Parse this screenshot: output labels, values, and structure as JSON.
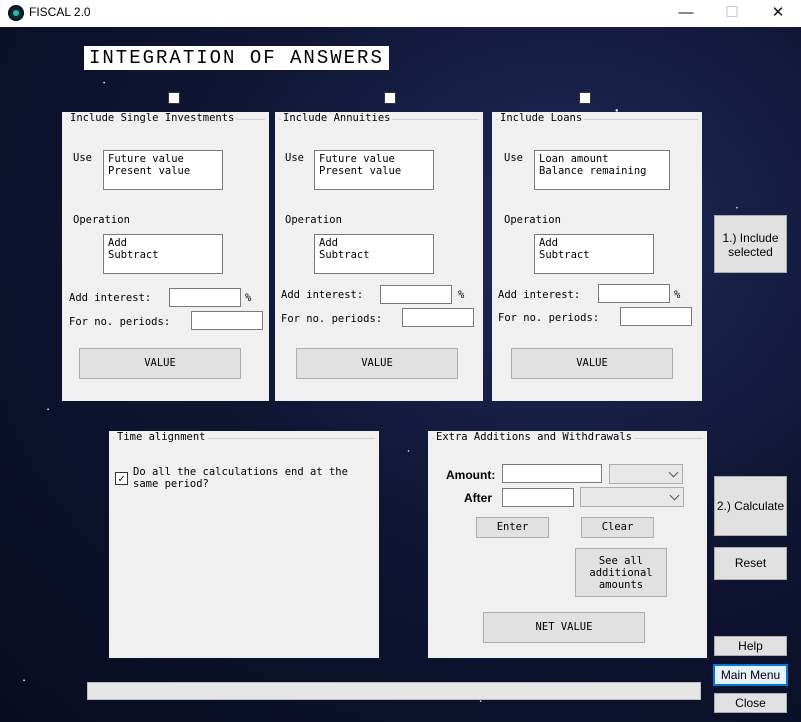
{
  "window": {
    "title": "FISCAL 2.0",
    "minimize": "—",
    "maximize": "☐",
    "close": "✕"
  },
  "heading": "INTEGRATION OF ANSWERS",
  "panels": [
    {
      "title": "Include Single Investments",
      "use_label": "Use",
      "use_items": [
        "Future value",
        "Present value"
      ],
      "operation_label": "Operation",
      "operation_items": [
        "Add",
        "Subtract"
      ],
      "interest_label": "Add interest:",
      "percent": "%",
      "periods_label": "For no. periods:",
      "value_button": "VALUE"
    },
    {
      "title": "Include Annuities",
      "use_label": "Use",
      "use_items": [
        "Future value",
        "Present value"
      ],
      "operation_label": "Operation",
      "operation_items": [
        "Add",
        "Subtract"
      ],
      "interest_label": "Add interest:",
      "percent": "%",
      "periods_label": "For no. periods:",
      "value_button": "VALUE"
    },
    {
      "title": "Include Loans",
      "use_label": "Use",
      "use_items": [
        "Loan amount",
        "Balance remaining"
      ],
      "operation_label": "Operation",
      "operation_items": [
        "Add",
        "Subtract"
      ],
      "interest_label": "Add interest:",
      "percent": "%",
      "periods_label": "For no. periods:",
      "value_button": "VALUE"
    }
  ],
  "time_alignment": {
    "title": "Time alignment",
    "checkbox_text": "Do all the calculations end at the same period?",
    "checked": true,
    "check_mark": "✓"
  },
  "extra": {
    "title": "Extra Additions and Withdrawals",
    "amount_label": "Amount:",
    "after_label": "After",
    "enter_button": "Enter",
    "clear_button": "Clear",
    "see_all_button": "See all additional amounts",
    "net_value_button": "NET VALUE"
  },
  "side_buttons": {
    "include_selected": "1.) Include selected",
    "calculate": "2.) Calculate",
    "reset": "Reset",
    "help": "Help",
    "main_menu": "Main Menu",
    "close": "Close"
  },
  "colors": {
    "panel_bg": "#f0f0f0",
    "button_bg": "#e1e1e1",
    "focus_border": "#0078d7"
  }
}
